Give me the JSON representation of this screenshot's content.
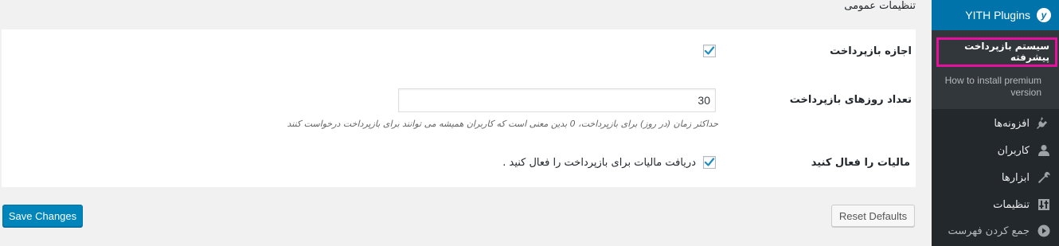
{
  "page": {
    "title": "تنظیمات عمومی"
  },
  "settings": {
    "allow_refund": {
      "label": "اجازه بازپرداخت",
      "checked": true
    },
    "refund_days": {
      "label": "تعداد روزهای بازپرداخت",
      "value": "30",
      "description": "حداکثر زمان (در روز) برای بازپرداخت، 0 بدین معنی است که کاربران همیشه می توانند برای بازپرداخت درخواست کنند"
    },
    "enable_tax": {
      "label": "مالیات را فعال کنید",
      "checkbox_label": "دریافت مالیات برای بازپرداخت را فعال کنید .",
      "checked": true
    }
  },
  "buttons": {
    "save": "Save Changes",
    "reset": "Reset Defaults"
  },
  "sidebar": {
    "header": {
      "label": "YITH Plugins",
      "icon": "yith-icon"
    },
    "submenu": [
      {
        "label": "سیستم بازپرداخت پیشرفته",
        "current": true
      },
      {
        "label": "How to install premium version",
        "current": false
      }
    ],
    "items": [
      {
        "label": "افزونه‌ها",
        "icon": "plugins-icon"
      },
      {
        "label": "کاربران",
        "icon": "users-icon"
      },
      {
        "label": "ابزارها",
        "icon": "tools-icon"
      },
      {
        "label": "تنظیمات",
        "icon": "settings-icon"
      },
      {
        "label": "جمع کردن فهرست",
        "icon": "collapse-icon"
      }
    ]
  },
  "colors": {
    "accent": "#0073aa",
    "primary_button": "#0085ba",
    "highlight_border": "#e60f9e",
    "sidebar_bg": "#23282d",
    "submenu_bg": "#32373c",
    "checkmark": "#1e8cbe"
  }
}
